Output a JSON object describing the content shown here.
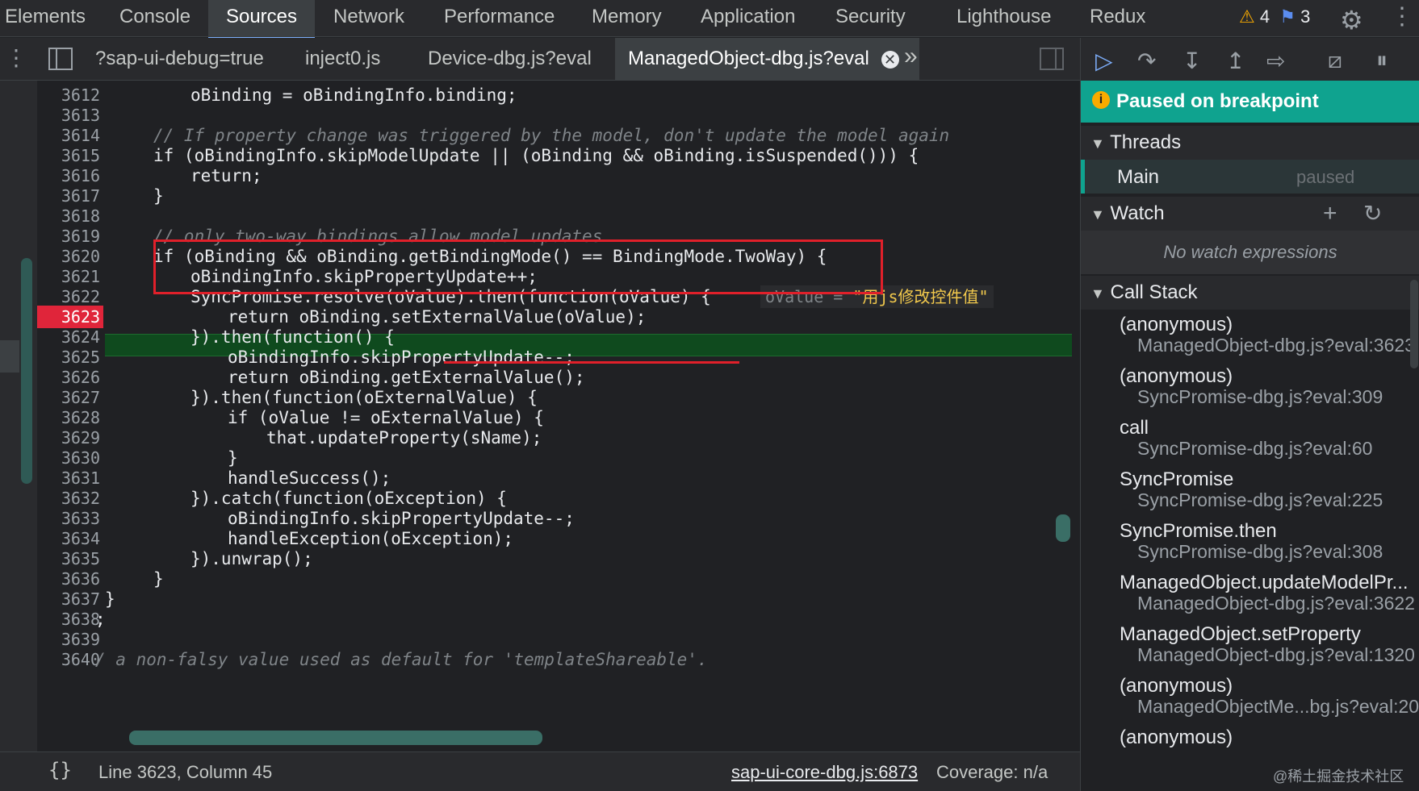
{
  "top_tabs": [
    "Elements",
    "Console",
    "Sources",
    "Network",
    "Performance",
    "Memory",
    "Application",
    "Security",
    "Lighthouse",
    "Redux"
  ],
  "warnings_count": "4",
  "messages_count": "3",
  "file_tabs": [
    "?sap-ui-debug=true",
    "inject0.js",
    "Device-dbg.js?eval",
    "ManagedObject-dbg.js?eval"
  ],
  "more_tabs_glyph": "»",
  "editor": {
    "lines": [
      {
        "n": "3612",
        "t": "oBinding = oBindingInfo.binding;"
      },
      {
        "n": "3613",
        "t": ""
      },
      {
        "n": "3614",
        "t": "// If property change was triggered by the model, don't update the model again"
      },
      {
        "n": "3615",
        "t": "if (oBindingInfo.skipModelUpdate || (oBinding && oBinding.isSuspended())) {"
      },
      {
        "n": "3616",
        "t": "return;"
      },
      {
        "n": "3617",
        "t": "}"
      },
      {
        "n": "3618",
        "t": ""
      },
      {
        "n": "3619",
        "t": "// only two-way bindings allow model updates"
      },
      {
        "n": "3620",
        "t": "if (oBinding && oBinding.getBindingMode() == BindingMode.TwoWay) {"
      },
      {
        "n": "3621",
        "t": "oBindingInfo.skipPropertyUpdate++;"
      },
      {
        "n": "3622",
        "t": "SyncPromise.resolve(oValue).then(function(oValue) {"
      },
      {
        "n": "3623",
        "t": "return oBinding.setExternalValue(oValue);"
      },
      {
        "n": "3624",
        "t": "}).then(function() {"
      },
      {
        "n": "3625",
        "t": "oBindingInfo.skipPropertyUpdate--;"
      },
      {
        "n": "3626",
        "t": "return oBinding.getExternalValue();"
      },
      {
        "n": "3627",
        "t": "}).then(function(oExternalValue) {"
      },
      {
        "n": "3628",
        "t": "if (oValue != oExternalValue) {"
      },
      {
        "n": "3629",
        "t": "that.updateProperty(sName);"
      },
      {
        "n": "3630",
        "t": "}"
      },
      {
        "n": "3631",
        "t": "handleSuccess();"
      },
      {
        "n": "3632",
        "t": "}).catch(function(oException) {"
      },
      {
        "n": "3633",
        "t": "oBindingInfo.skipPropertyUpdate--;"
      },
      {
        "n": "3634",
        "t": "handleException(oException);"
      },
      {
        "n": "3635",
        "t": "}).unwrap();"
      },
      {
        "n": "3636",
        "t": "}"
      },
      {
        "n": "3637",
        "t": "}"
      },
      {
        "n": "3638",
        "t": ";"
      },
      {
        "n": "3639",
        "t": ""
      },
      {
        "n": "3640",
        "t": "/ a non-falsy value used as default for 'templateShareable'."
      }
    ],
    "inline_value_label": "oValue = ",
    "inline_value": "\"用js修改控件值\"",
    "breakpoint_line": "3623"
  },
  "status": {
    "cursor": "Line 3623, Column 45",
    "source_link": "sap-ui-core-dbg.js:6873",
    "coverage": "Coverage: n/a"
  },
  "debugger": {
    "paused_message": "Paused on breakpoint",
    "threads_title": "Threads",
    "thread_name": "Main",
    "thread_state": "paused",
    "watch_title": "Watch",
    "watch_empty": "No watch expressions",
    "callstack_title": "Call Stack",
    "frames": [
      {
        "fn": "(anonymous)",
        "loc": "ManagedObject-dbg.js?eval:3623"
      },
      {
        "fn": "(anonymous)",
        "loc": "SyncPromise-dbg.js?eval:309"
      },
      {
        "fn": "call",
        "loc": "SyncPromise-dbg.js?eval:60"
      },
      {
        "fn": "SyncPromise",
        "loc": "SyncPromise-dbg.js?eval:225"
      },
      {
        "fn": "SyncPromise.then",
        "loc": "SyncPromise-dbg.js?eval:308"
      },
      {
        "fn": "ManagedObject.updateModelPr...",
        "loc": "ManagedObject-dbg.js?eval:3622"
      },
      {
        "fn": "ManagedObject.setProperty",
        "loc": "ManagedObject-dbg.js?eval:1320"
      },
      {
        "fn": "(anonymous)",
        "loc": "ManagedObjectMe...bg.js?eval:20"
      },
      {
        "fn": "(anonymous)",
        "loc": ""
      }
    ]
  },
  "watermark": "@稀土掘金技术社区",
  "colors": {
    "accent": "#7cacf8",
    "paused_banner": "#0fa38f",
    "breakpoint": "#e0253a",
    "current_line": "#0f4a1e"
  }
}
